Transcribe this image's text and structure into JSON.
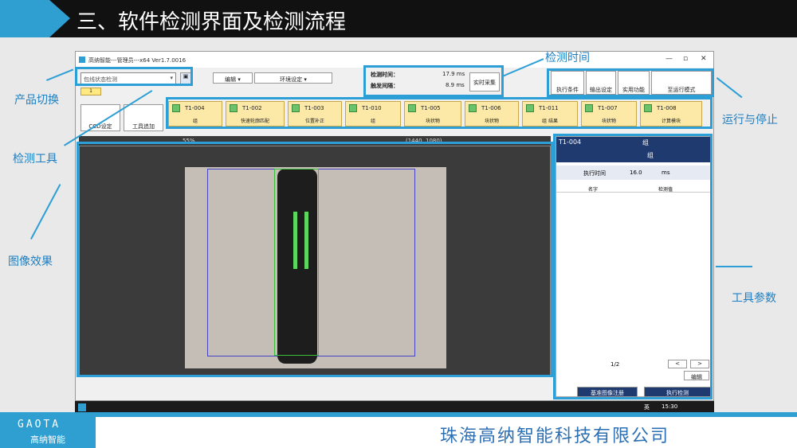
{
  "header": {
    "title": "三、软件检测界面及检测流程"
  },
  "annotations": {
    "product_switch": "产品切换",
    "detect_tools": "检测工具",
    "image_effect": "图像效果",
    "detect_time": "检测时间",
    "run_stop": "运行与停止",
    "tool_params": "工具参数"
  },
  "app": {
    "window_title": "高纳智能---管理员---x64 Ver1.7.0016",
    "product_combo": "包线状态检测",
    "menu_edit": "编辑",
    "menu_env": "环境设定",
    "detect_time_label": "检测时间：",
    "detect_time_value": "17.9 ms",
    "trigger_label": "触发间隔：",
    "trigger_value": "8.9 ms",
    "realtime_button": "实时采集",
    "ccd_button": "CCD设定",
    "tool_add_button": "工具追加",
    "tools": [
      {
        "id": "T1-004",
        "name": "组"
      },
      {
        "id": "T1-002",
        "name": "快速轮廓匹配"
      },
      {
        "id": "T1-003",
        "name": "位置补正"
      },
      {
        "id": "T1-010",
        "name": "组"
      },
      {
        "id": "T1-005",
        "name": "块状物"
      },
      {
        "id": "T1-006",
        "name": "块状物"
      },
      {
        "id": "T1-011",
        "name": "组 结果"
      },
      {
        "id": "T1-007",
        "name": "块状物"
      },
      {
        "id": "T1-008",
        "name": "计算模块"
      }
    ],
    "right_buttons": [
      "执行条件",
      "输出设定",
      "实用功能",
      "至运行模式"
    ],
    "zoom": "55%",
    "resolution": "(1440, 1080)",
    "panel": {
      "tool_id": "T1-004",
      "tool_group": "组",
      "tool_name": "组",
      "exec_time_label": "执行时间",
      "exec_time_value": "16.0",
      "exec_time_unit": "ms",
      "col_name": "名字",
      "col_value": "检测值",
      "page": "1/2",
      "prev": "<",
      "next": ">",
      "edit_button": "编辑",
      "register_button": "基准图像注册",
      "run_button": "执行检测"
    },
    "taskbar": {
      "ime": "英",
      "time": "15:30"
    }
  },
  "footer": {
    "logo": "GAOTA",
    "logo_cn": "高纳智能",
    "company": "珠海高纳智能科技有限公司"
  }
}
